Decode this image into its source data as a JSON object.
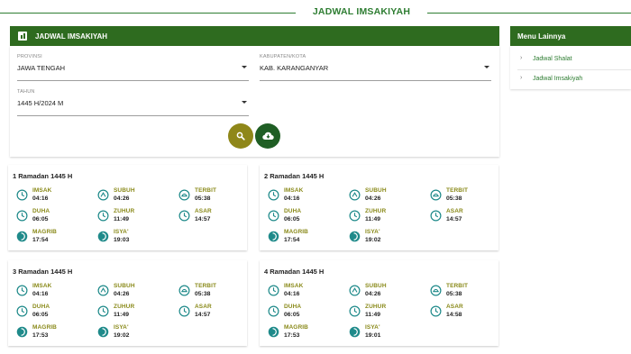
{
  "page_title": "JADWAL IMSAKIYAH",
  "colors": {
    "brand_green": "#2e6b1f",
    "title_green": "#2e7d32",
    "name_olive": "#8a8a1a",
    "search_btn": "#8f8719",
    "download_btn": "#1f5e24",
    "icon_teal": "#1f8a8a"
  },
  "panel": {
    "header": "JADWAL IMSAKIYAH",
    "header_icon": "chart-icon",
    "provinsi": {
      "label": "PROVINSI",
      "value": "JAWA TENGAH"
    },
    "kabupaten": {
      "label": "KABUPATEN/KOTA",
      "value": "KAB. KARANGANYAR"
    },
    "tahun": {
      "label": "TAHUN",
      "value": "1445 H/2024 M"
    },
    "search_icon": "search-icon",
    "download_icon": "cloud-download-icon"
  },
  "cards": [
    {
      "title": "1 Ramadan 1445 H",
      "times": [
        {
          "name": "IMSAK",
          "time": "04:16"
        },
        {
          "name": "SUBUH",
          "time": "04:26"
        },
        {
          "name": "TERBIT",
          "time": "05:38"
        },
        {
          "name": "DUHA",
          "time": "06:05"
        },
        {
          "name": "ZUHUR",
          "time": "11:49"
        },
        {
          "name": "ASAR",
          "time": "14:57"
        },
        {
          "name": "MAGRIB",
          "time": "17:54"
        },
        {
          "name": "ISYA'",
          "time": "19:03"
        }
      ]
    },
    {
      "title": "2 Ramadan 1445 H",
      "times": [
        {
          "name": "IMSAK",
          "time": "04:16"
        },
        {
          "name": "SUBUH",
          "time": "04:26"
        },
        {
          "name": "TERBIT",
          "time": "05:38"
        },
        {
          "name": "DUHA",
          "time": "06:05"
        },
        {
          "name": "ZUHUR",
          "time": "11:49"
        },
        {
          "name": "ASAR",
          "time": "14:57"
        },
        {
          "name": "MAGRIB",
          "time": "17:54"
        },
        {
          "name": "ISYA'",
          "time": "19:02"
        }
      ]
    },
    {
      "title": "3 Ramadan 1445 H",
      "times": [
        {
          "name": "IMSAK",
          "time": "04:16"
        },
        {
          "name": "SUBUH",
          "time": "04:26"
        },
        {
          "name": "TERBIT",
          "time": "05:38"
        },
        {
          "name": "DUHA",
          "time": "06:05"
        },
        {
          "name": "ZUHUR",
          "time": "11:49"
        },
        {
          "name": "ASAR",
          "time": "14:57"
        },
        {
          "name": "MAGRIB",
          "time": "17:53"
        },
        {
          "name": "ISYA'",
          "time": "19:02"
        }
      ]
    },
    {
      "title": "4 Ramadan 1445 H",
      "times": [
        {
          "name": "IMSAK",
          "time": "04:16"
        },
        {
          "name": "SUBUH",
          "time": "04:26"
        },
        {
          "name": "TERBIT",
          "time": "05:38"
        },
        {
          "name": "DUHA",
          "time": "06:05"
        },
        {
          "name": "ZUHUR",
          "time": "11:49"
        },
        {
          "name": "ASAR",
          "time": "14:58"
        },
        {
          "name": "MAGRIB",
          "time": "17:53"
        },
        {
          "name": "ISYA'",
          "time": "19:01"
        }
      ]
    }
  ],
  "side_menu": {
    "header": "Menu Lainnya",
    "items": [
      {
        "label": "Jadwal Shalat"
      },
      {
        "label": "Jadwal Imsakiyah"
      }
    ]
  }
}
